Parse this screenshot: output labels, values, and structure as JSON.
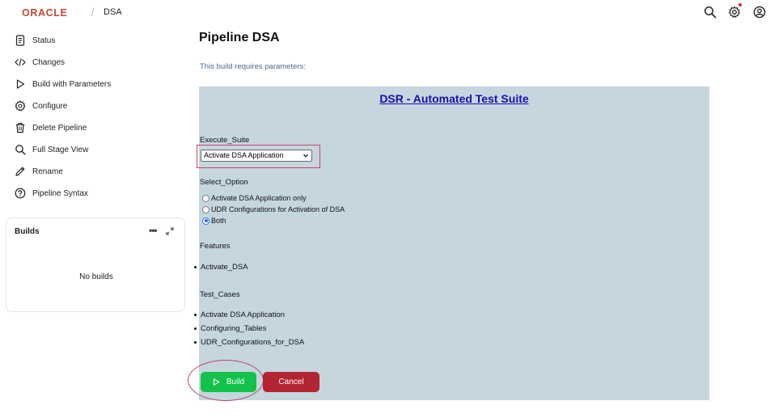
{
  "header": {
    "logo": "ORACLE",
    "breadcrumb_separator": "/",
    "breadcrumb": "DSA",
    "icons": [
      "search-icon",
      "settings-icon",
      "user-icon"
    ],
    "notification_color": "#e0243b"
  },
  "sidebar": {
    "items": [
      {
        "label": "Status",
        "icon": "status-icon"
      },
      {
        "label": "Changes",
        "icon": "code-icon"
      },
      {
        "label": "Build with Parameters",
        "icon": "play-icon"
      },
      {
        "label": "Configure",
        "icon": "gear-icon"
      },
      {
        "label": "Delete Pipeline",
        "icon": "trash-icon"
      },
      {
        "label": "Full Stage View",
        "icon": "search-icon"
      },
      {
        "label": "Rename",
        "icon": "pencil-icon"
      },
      {
        "label": "Pipeline Syntax",
        "icon": "help-icon"
      }
    ]
  },
  "builds": {
    "title": "Builds",
    "more": "•••",
    "empty": "No builds"
  },
  "main": {
    "title": "Pipeline DSA",
    "params_note": "This build requires parameters:",
    "suite_title": "DSR - Automated Test Suite",
    "execute_suite": {
      "label": "Execute_Suite",
      "selected": "Activate DSA Application"
    },
    "select_option": {
      "label": "Select_Option",
      "options": [
        {
          "label": "Activate DSA Application only",
          "checked": false
        },
        {
          "label": "UDR Configurations for Activation of DSA",
          "checked": false
        },
        {
          "label": "Both",
          "checked": true
        }
      ]
    },
    "features": {
      "label": "Features",
      "items": [
        "Activate_DSA"
      ]
    },
    "test_cases": {
      "label": "Test_Cases",
      "items": [
        "Activate DSA Application",
        "Configuring_Tables",
        "UDR_Configurations_for_DSA"
      ]
    },
    "build_label": "Build",
    "cancel_label": "Cancel",
    "colors": {
      "panel": "#c5d6df",
      "build": "#12c24a",
      "cancel": "#b52432",
      "highlight": "#c9436a"
    }
  }
}
